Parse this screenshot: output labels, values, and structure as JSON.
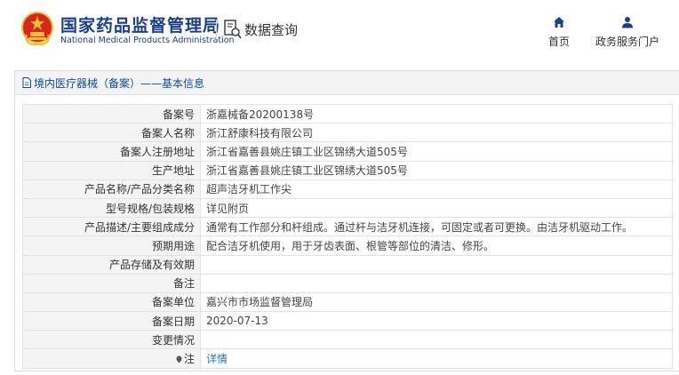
{
  "header": {
    "logo_cn": "国家药品监督管理局",
    "logo_en": "National Medical Products Administration",
    "query_label": "数据查询",
    "nav": [
      {
        "label": "首页",
        "icon": "home-icon"
      },
      {
        "label": "政务服务门户",
        "icon": "user-icon"
      }
    ]
  },
  "panel": {
    "title": "境内医疗器械（备案）——基本信息",
    "rows": [
      {
        "label": "备案号",
        "value": "浙嘉械备20200138号"
      },
      {
        "label": "备案人名称",
        "value": "浙江舒康科技有限公司"
      },
      {
        "label": "备案人注册地址",
        "value": "浙江省嘉善县姚庄镇工业区锦绣大道505号"
      },
      {
        "label": "生产地址",
        "value": "浙江省嘉善县姚庄镇工业区锦绣大道505号"
      },
      {
        "label": "产品名称/产品分类名称",
        "value": "超声洁牙机工作尖"
      },
      {
        "label": "型号规格/包装规格",
        "value": "详见附页"
      },
      {
        "label": "产品描述/主要组成成分",
        "value": "通常有工作部分和杆组成。通过杆与洁牙机连接，可固定或者可更换。由洁牙机驱动工作。"
      },
      {
        "label": "预期用途",
        "value": "配合洁牙机使用，用于牙齿表面、根管等部位的清洁、修形。"
      },
      {
        "label": "产品存储及有效期",
        "value": ""
      },
      {
        "label": "备注",
        "value": ""
      },
      {
        "label": "备案单位",
        "value": "嘉兴市市场监督管理局"
      },
      {
        "label": "备案日期",
        "value": "2020-07-13"
      },
      {
        "label": "变更情况",
        "value": ""
      },
      {
        "label": "注",
        "value": "详情"
      }
    ]
  },
  "colors": {
    "brand_blue": "#1b3f8f",
    "link_blue": "#2a6fc9",
    "emblem_red": "#d7261e",
    "emblem_gold": "#f2c02e"
  }
}
